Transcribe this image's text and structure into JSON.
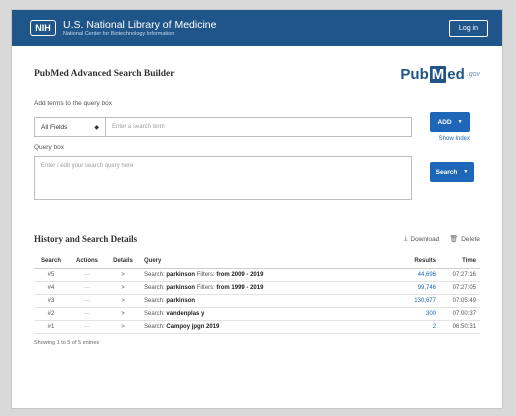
{
  "banner": {
    "logo_text": "NIH",
    "org_name": "U.S. National Library of Medicine",
    "org_sub": "National Center for Biotechnology Information",
    "login_label": "Log in"
  },
  "page": {
    "title": "PubMed Advanced Search Builder",
    "logo_pre": "Pub",
    "logo_box": "M",
    "logo_post": "ed",
    "logo_gov": ".gov"
  },
  "builder": {
    "label": "Add terms to the query box",
    "field_value": "All Fields",
    "term_placeholder": "Enter a search term",
    "add_label": "ADD",
    "show_index": "Show Index"
  },
  "query": {
    "label": "Query box",
    "placeholder": "Enter / edit your search query here",
    "search_label": "Search"
  },
  "history": {
    "title": "History and Search Details",
    "download_label": "Download",
    "delete_label": "Delete",
    "columns": [
      "Search",
      "Actions",
      "Details",
      "Query",
      "Results",
      "Time"
    ],
    "rows": [
      {
        "num": "#5",
        "actions": "···",
        "details": ">",
        "prefix": "Search:",
        "term": "parkinson",
        "filter_label": "Filters:",
        "filter": "from 2009 - 2019",
        "results": "44,696",
        "time": "07:27:16"
      },
      {
        "num": "#4",
        "actions": "···",
        "details": ">",
        "prefix": "Search:",
        "term": "parkinson",
        "filter_label": "Filters:",
        "filter": "from 1999 - 2019",
        "results": "99,746",
        "time": "07:27:05"
      },
      {
        "num": "#3",
        "actions": "···",
        "details": ">",
        "prefix": "Search:",
        "term": "parkinson",
        "filter_label": "",
        "filter": "",
        "results": "130,677",
        "time": "07:05:49"
      },
      {
        "num": "#2",
        "actions": "···",
        "details": ">",
        "prefix": "Search:",
        "term": "vandenplas y",
        "filter_label": "",
        "filter": "",
        "results": "300",
        "time": "07:00:37"
      },
      {
        "num": "#1",
        "actions": "···",
        "details": ">",
        "prefix": "Search:",
        "term": "Campoy jpgn 2019",
        "filter_label": "",
        "filter": "",
        "results": "2",
        "time": "06:50:31"
      }
    ],
    "footer": "Showing 1 to 5 of 5 entries"
  },
  "icons": {
    "download": "download-icon",
    "delete": "trash-icon",
    "select_caret": "caret-updown-icon",
    "dropdown": "chevron-down-icon"
  },
  "colors": {
    "banner": "#20558a",
    "button": "#1e66b7",
    "link": "#1e66b7"
  }
}
